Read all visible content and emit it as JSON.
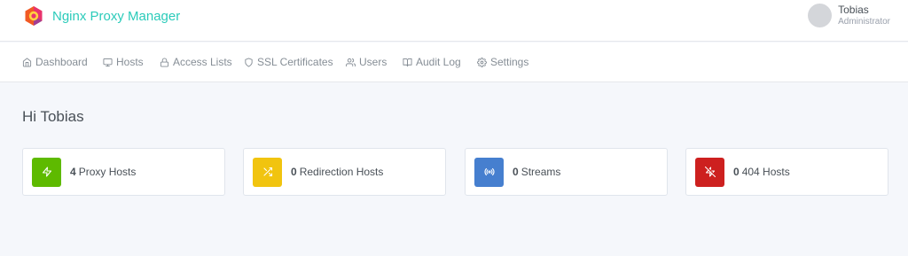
{
  "app": {
    "title": "Nginx Proxy Manager",
    "accent": "#2bcbba"
  },
  "user": {
    "name": "Tobias",
    "role": "Administrator"
  },
  "nav": [
    {
      "label": "Dashboard",
      "icon": "home-icon"
    },
    {
      "label": "Hosts",
      "icon": "monitor-icon"
    },
    {
      "label": "Access Lists",
      "icon": "lock-icon"
    },
    {
      "label": "SSL Certificates",
      "icon": "shield-icon"
    },
    {
      "label": "Users",
      "icon": "users-icon"
    },
    {
      "label": "Audit Log",
      "icon": "book-icon"
    },
    {
      "label": "Settings",
      "icon": "gear-icon"
    }
  ],
  "greeting": "Hi Tobias",
  "stats": [
    {
      "count": "4",
      "label": "Proxy Hosts",
      "color": "#5eba00",
      "icon": "zap-icon"
    },
    {
      "count": "0",
      "label": "Redirection Hosts",
      "color": "#f1c40f",
      "icon": "shuffle-icon"
    },
    {
      "count": "0",
      "label": "Streams",
      "color": "#467fcf",
      "icon": "radio-icon"
    },
    {
      "count": "0",
      "label": "404 Hosts",
      "color": "#cd201f",
      "icon": "zap-off-icon"
    }
  ]
}
